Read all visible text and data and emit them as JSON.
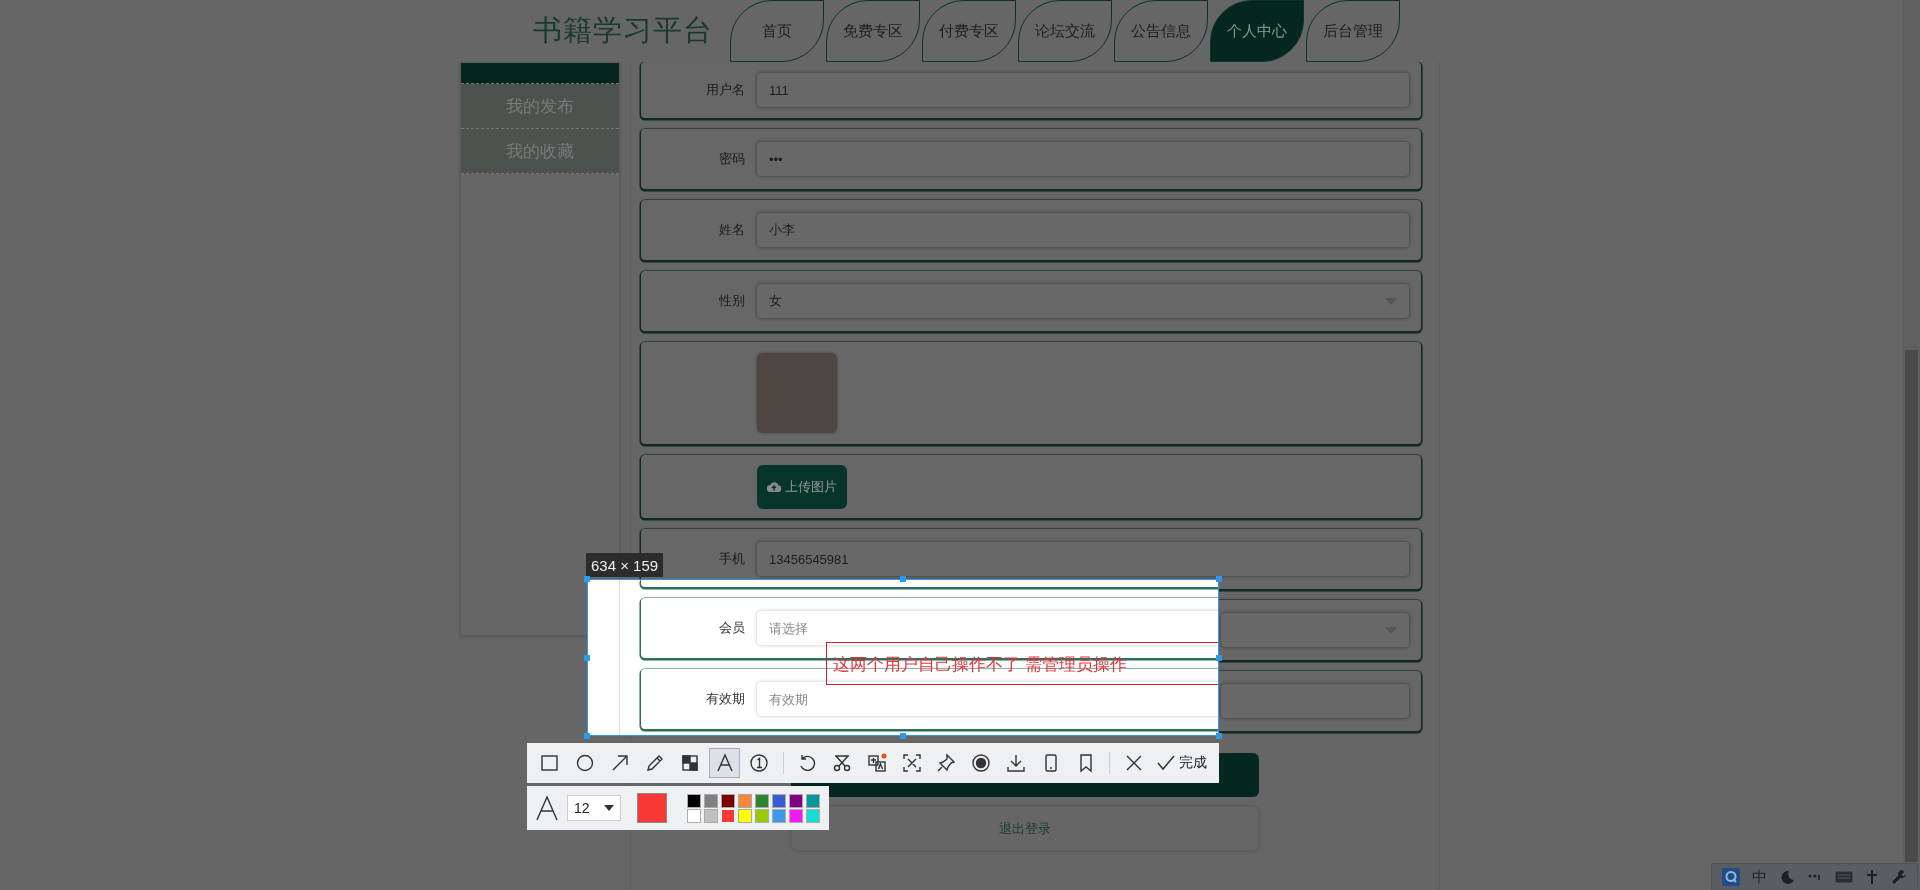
{
  "header": {
    "title": "书籍学习平台",
    "tabs": [
      {
        "label": "首页",
        "selected": false
      },
      {
        "label": "免费专区",
        "selected": false
      },
      {
        "label": "付费专区",
        "selected": false
      },
      {
        "label": "论坛交流",
        "selected": false
      },
      {
        "label": "公告信息",
        "selected": false
      },
      {
        "label": "个人中心",
        "selected": true
      },
      {
        "label": "后台管理",
        "selected": false
      }
    ]
  },
  "sidebar": {
    "items": [
      {
        "selected": true
      },
      {
        "label": "我的发布",
        "selected": false
      },
      {
        "label": "我的收藏",
        "selected": false
      }
    ]
  },
  "form": {
    "rows": [
      {
        "kind": "input",
        "label": "用户名",
        "value": "111"
      },
      {
        "kind": "input",
        "label": "密码",
        "value": "•••"
      },
      {
        "kind": "input",
        "label": "姓名",
        "value": "小李"
      },
      {
        "kind": "select",
        "label": "性别",
        "value": "女"
      },
      {
        "kind": "image"
      },
      {
        "kind": "upload",
        "button": "上传图片"
      },
      {
        "kind": "input",
        "label": "手机",
        "value": "13456545981"
      },
      {
        "kind": "select"
      },
      {
        "kind": "input"
      }
    ],
    "logout_button": "退出登录"
  },
  "capture": {
    "size": "634 × 159",
    "rows": [
      {
        "label": "会员",
        "placeholder": "请选择"
      },
      {
        "label": "有效期",
        "placeholder": "有效期"
      }
    ],
    "annotation": "这两个用户自己操作不了  需管理员操作",
    "tools": [
      {
        "kind": "rectangle",
        "selected": false
      },
      {
        "kind": "ellipse",
        "selected": false
      },
      {
        "kind": "arrow",
        "selected": false
      },
      {
        "kind": "pencil",
        "selected": false
      },
      {
        "kind": "mosaic",
        "selected": false
      },
      {
        "kind": "text",
        "selected": true
      },
      {
        "kind": "number",
        "selected": false
      }
    ],
    "actions": [
      {
        "kind": "undo"
      },
      {
        "kind": "cut"
      },
      {
        "kind": "translate"
      },
      {
        "kind": "ocr"
      },
      {
        "kind": "pin"
      },
      {
        "kind": "record"
      },
      {
        "kind": "download"
      },
      {
        "kind": "phone"
      },
      {
        "kind": "bookmark"
      }
    ],
    "done": "完成",
    "font_size": "12",
    "palette": [
      {
        "color": "#000000",
        "selected": false
      },
      {
        "color": "#808080",
        "selected": false
      },
      {
        "color": "#800000",
        "selected": false
      },
      {
        "color": "#f7883a",
        "selected": false
      },
      {
        "color": "#308430",
        "selected": false
      },
      {
        "color": "#385ad3",
        "selected": false
      },
      {
        "color": "#800080",
        "selected": false
      },
      {
        "color": "#009999",
        "selected": false
      },
      {
        "color": "#ffffff",
        "selected": false
      },
      {
        "color": "#c0c0c0",
        "selected": false
      },
      {
        "color": "#fb3838",
        "selected": true
      },
      {
        "color": "#ffff00",
        "selected": false
      },
      {
        "color": "#99cc00",
        "selected": false
      },
      {
        "color": "#3d9be9",
        "selected": false
      },
      {
        "color": "#f31bf3",
        "selected": false
      },
      {
        "color": "#16dcdc",
        "selected": false
      }
    ]
  },
  "tray": {
    "ime": "中"
  }
}
